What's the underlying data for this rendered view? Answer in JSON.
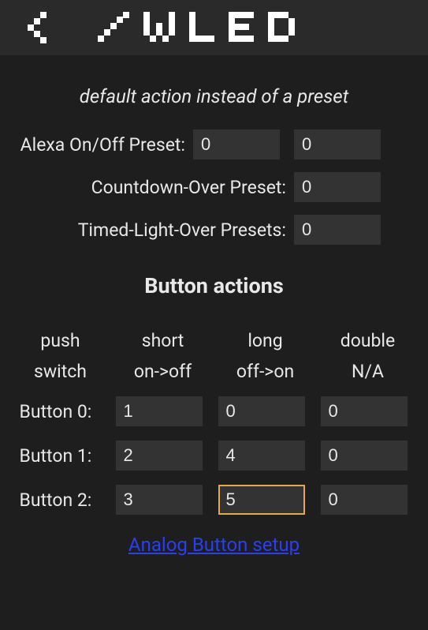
{
  "header": {
    "back_icon_name": "back",
    "logo_text": "WLED"
  },
  "subtitle": "default action instead of a preset",
  "presets": {
    "alexa_label": "Alexa On/Off Preset:",
    "alexa_on": "0",
    "alexa_off": "0",
    "countdown_label": "Countdown-Over Preset:",
    "countdown_val": "0",
    "timed_label": "Timed-Light-Over Presets:",
    "timed_val": "0"
  },
  "button_actions": {
    "heading": "Button actions",
    "header_row1": [
      "push",
      "short",
      "long",
      "double"
    ],
    "header_row2": [
      "switch",
      "on->off",
      "off->on",
      "N/A"
    ],
    "rows": [
      {
        "label": "Button 0:",
        "short": "1",
        "long": "0",
        "double": "0"
      },
      {
        "label": "Button 1:",
        "short": "2",
        "long": "4",
        "double": "0"
      },
      {
        "label": "Button 2:",
        "short": "3",
        "long": "5",
        "double": "0"
      }
    ]
  },
  "link_label": "Analog Button setup"
}
